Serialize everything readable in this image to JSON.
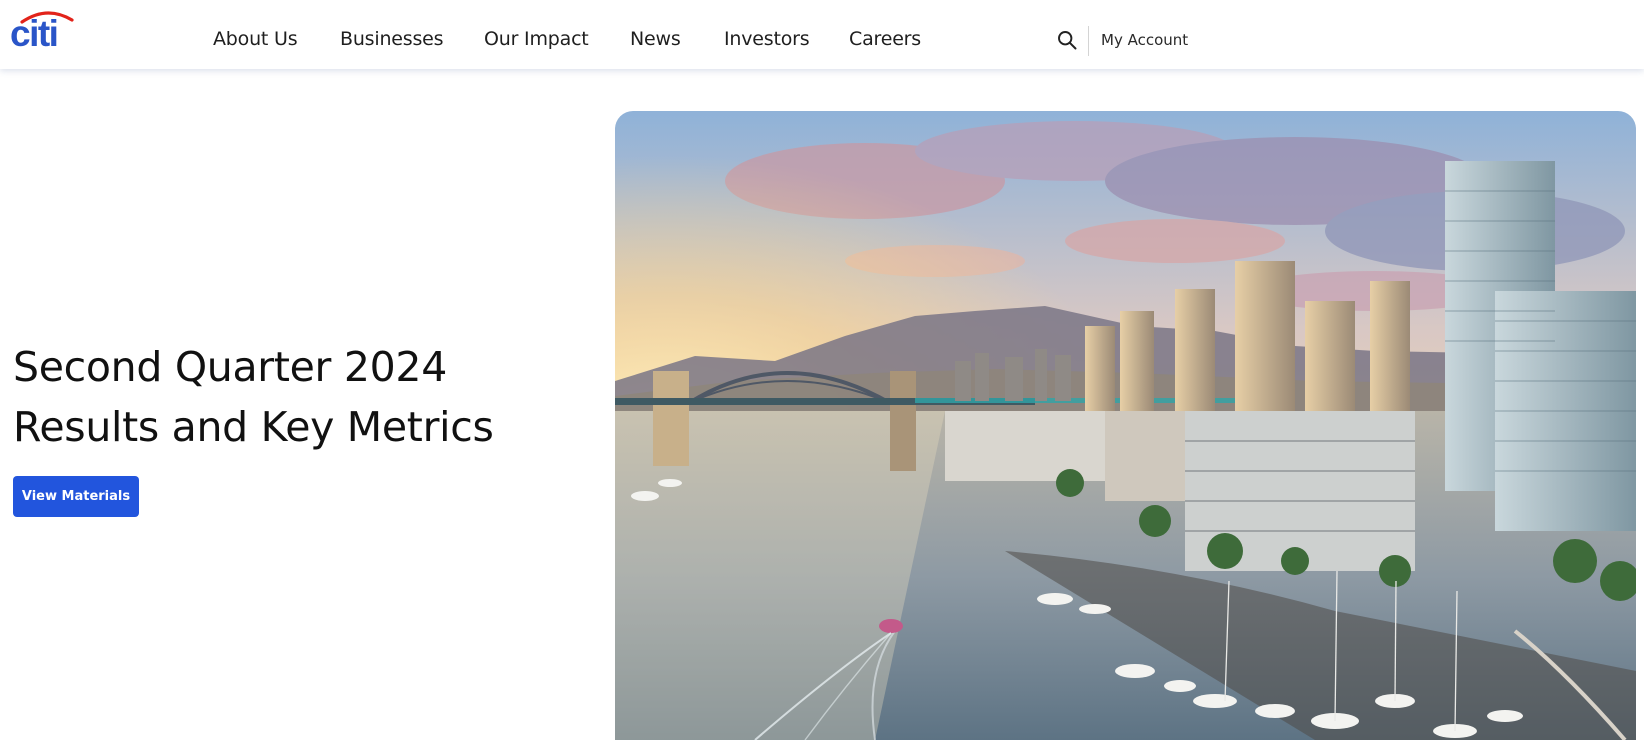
{
  "brand": {
    "logo_text": "citi",
    "logo_color": "#2a55c8",
    "arc_color": "#e2231a"
  },
  "nav": {
    "items": [
      {
        "label": "About Us"
      },
      {
        "label": "Businesses"
      },
      {
        "label": "Our Impact"
      },
      {
        "label": "News"
      },
      {
        "label": "Investors"
      },
      {
        "label": "Careers"
      }
    ]
  },
  "header": {
    "search_icon": "search-icon",
    "account_label": "My Account"
  },
  "hero": {
    "title_line1": "Second Quarter 2024",
    "title_line2": "Results and Key Metrics",
    "button_label": "View Materials",
    "button_color": "#2255dd",
    "image_subject": "Vancouver waterfront at sunset"
  }
}
